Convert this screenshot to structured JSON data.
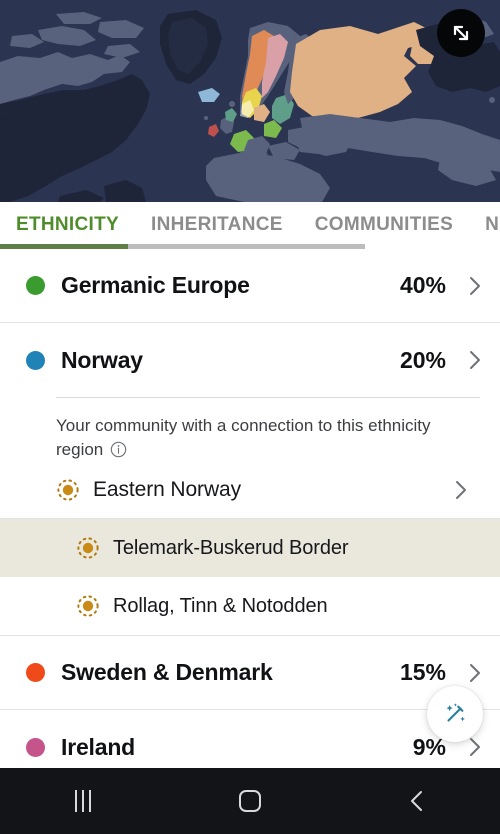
{
  "map": {
    "alt_name": "world-ethnicity-map",
    "expand_icon": "expand-arrows-icon",
    "background_color": "#2b3450",
    "land_color": "#59627d",
    "land_dark_color": "#1e2539",
    "region_colors": {
      "tan": "#e0b184",
      "orange": "#e08a55",
      "pink": "#d9a0a8",
      "green": "#7cba4e",
      "teal": "#5f9e88",
      "blue": "#8fb8d8",
      "light_blue": "#a8c9e0",
      "red": "#c0504d",
      "yellow": "#e8d44d"
    }
  },
  "tabs": {
    "items": [
      {
        "label": "ETHNICITY",
        "active": true
      },
      {
        "label": "INHERITANCE",
        "active": false
      },
      {
        "label": "COMMUNITIES",
        "active": false
      },
      {
        "label": "NEX",
        "active": false
      }
    ],
    "active_color": "#4f8c2c",
    "inactive_color": "#8c8c8c",
    "scroll_thumb_color": "#5f7f46",
    "scroll_track_color": "#bdbdbd"
  },
  "ethnicities": [
    {
      "name": "Germanic Europe",
      "percent": "40%",
      "color": "#3a9c2f"
    },
    {
      "name": "Norway",
      "percent": "20%",
      "color": "#2083b8"
    },
    {
      "name": "Sweden & Denmark",
      "percent": "15%",
      "color": "#f04a1a"
    },
    {
      "name": "Ireland",
      "percent": "9%",
      "color": "#c4548a"
    }
  ],
  "community": {
    "note": "Your community with a connection to this ethnicity region",
    "info_icon": "info-circle-icon",
    "icon_color": "#b07a10",
    "parent": {
      "label": "Eastern Norway",
      "icon": "community-dotted-circle-icon"
    },
    "children": [
      {
        "label": "Telemark-Buskerud Border",
        "icon": "community-dotted-circle-icon",
        "selected": true
      },
      {
        "label": "Rollag, Tinn & Notodden",
        "icon": "community-dotted-circle-icon",
        "selected": false
      }
    ],
    "selected_background": "#eae7dc"
  },
  "fab": {
    "icon": "magic-wand-sparkle-icon",
    "icon_color": "#2b7f9e"
  },
  "navbar": {
    "recents": "recents-icon",
    "home": "home-icon",
    "back": "back-icon",
    "background_color": "#131418"
  }
}
